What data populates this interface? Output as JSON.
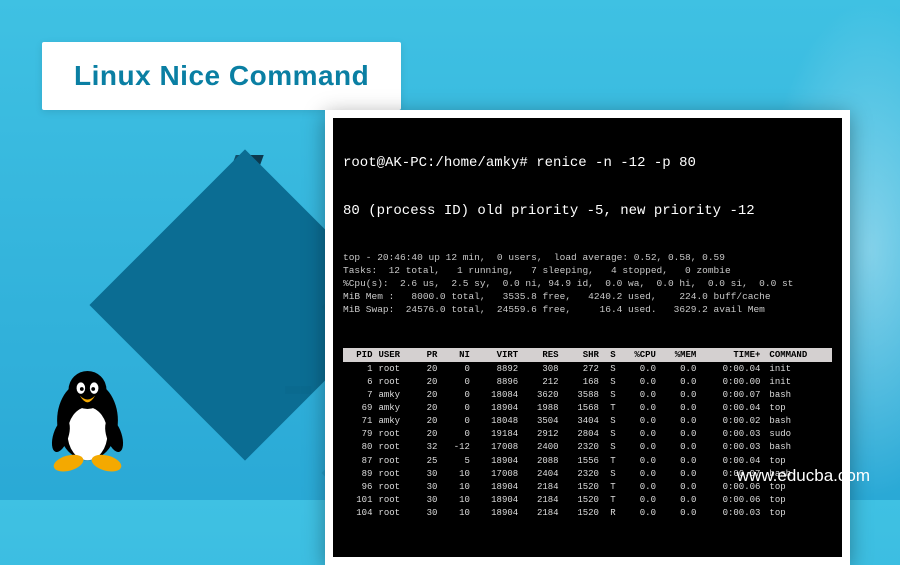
{
  "title": "Linux Nice Command",
  "site_url": "www.educba.com",
  "terminal": {
    "prompt": "root@AK-PC:/home/amky#",
    "command": "renice -n -12 -p 80",
    "message": "80 (process ID) old priority -5, new priority -12",
    "summary_lines": [
      "top - 20:46:40 up 12 min,  0 users,  load average: 0.52, 0.58, 0.59",
      "Tasks:  12 total,   1 running,   7 sleeping,   4 stopped,   0 zombie",
      "%Cpu(s):  2.6 us,  2.5 sy,  0.0 ni, 94.9 id,  0.0 wa,  0.0 hi,  0.0 si,  0.0 st",
      "MiB Mem :   8000.0 total,   3535.8 free,   4240.2 used,    224.0 buff/cache",
      "MiB Swap:  24576.0 total,  24559.6 free,     16.4 used.   3629.2 avail Mem"
    ],
    "headers": [
      "PID",
      "USER",
      "PR",
      "NI",
      "VIRT",
      "RES",
      "SHR",
      "S",
      "%CPU",
      "%MEM",
      "TIME+",
      "COMMAND"
    ],
    "rows": [
      [
        "1",
        "root",
        "20",
        "0",
        "8892",
        "308",
        "272",
        "S",
        "0.0",
        "0.0",
        "0:00.04",
        "init"
      ],
      [
        "6",
        "root",
        "20",
        "0",
        "8896",
        "212",
        "168",
        "S",
        "0.0",
        "0.0",
        "0:00.00",
        "init"
      ],
      [
        "7",
        "amky",
        "20",
        "0",
        "18084",
        "3620",
        "3588",
        "S",
        "0.0",
        "0.0",
        "0:00.07",
        "bash"
      ],
      [
        "69",
        "amky",
        "20",
        "0",
        "18904",
        "1988",
        "1568",
        "T",
        "0.0",
        "0.0",
        "0:00.04",
        "top"
      ],
      [
        "71",
        "amky",
        "20",
        "0",
        "18048",
        "3504",
        "3404",
        "S",
        "0.0",
        "0.0",
        "0:00.02",
        "bash"
      ],
      [
        "79",
        "root",
        "20",
        "0",
        "19184",
        "2912",
        "2804",
        "S",
        "0.0",
        "0.0",
        "0:00.03",
        "sudo"
      ],
      [
        "80",
        "root",
        "32",
        "-12",
        "17008",
        "2400",
        "2320",
        "S",
        "0.0",
        "0.0",
        "0:00.03",
        "bash"
      ],
      [
        "87",
        "root",
        "25",
        "5",
        "18904",
        "2088",
        "1556",
        "T",
        "0.0",
        "0.0",
        "0:00.04",
        "top"
      ],
      [
        "89",
        "root",
        "30",
        "10",
        "17008",
        "2404",
        "2320",
        "S",
        "0.0",
        "0.0",
        "0:00.07",
        "bash"
      ],
      [
        "96",
        "root",
        "30",
        "10",
        "18904",
        "2184",
        "1520",
        "T",
        "0.0",
        "0.0",
        "0:00.06",
        "top"
      ],
      [
        "101",
        "root",
        "30",
        "10",
        "18904",
        "2184",
        "1520",
        "T",
        "0.0",
        "0.0",
        "0:00.06",
        "top"
      ],
      [
        "104",
        "root",
        "30",
        "10",
        "18904",
        "2184",
        "1520",
        "R",
        "0.0",
        "0.0",
        "0:00.03",
        "top"
      ]
    ]
  }
}
